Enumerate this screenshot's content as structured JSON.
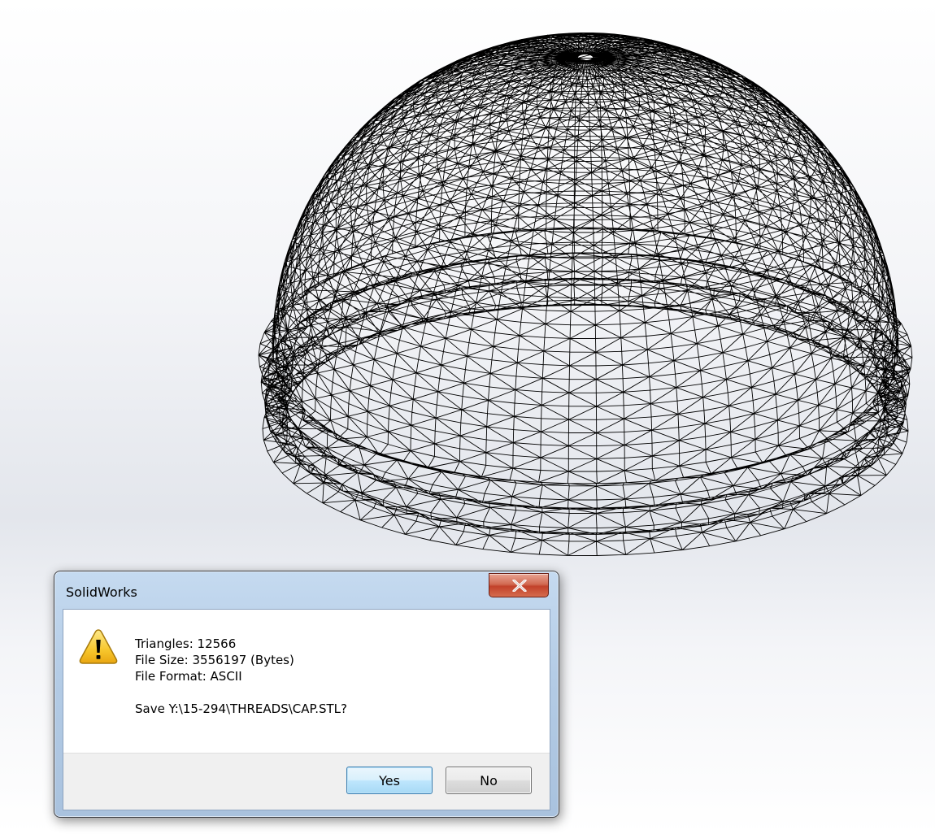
{
  "viewport": {
    "model_icon": "wireframe-cap-model"
  },
  "dialog": {
    "title": "SolidWorks",
    "close_glyph": "X",
    "icon": "warning-icon",
    "message_lines": [
      "Triangles: 12566",
      "File Size: 3556197 (Bytes)",
      "File Format: ASCII"
    ],
    "question": "Save Y:\\15-294\\THREADS\\CAP.STL?",
    "buttons": {
      "yes": "Yes",
      "no": "No"
    }
  },
  "colors": {
    "wire": "#000000",
    "close_button": "#c2412a",
    "default_button_border": "#3c7fb1",
    "warning_fill": "#f7c72d"
  }
}
